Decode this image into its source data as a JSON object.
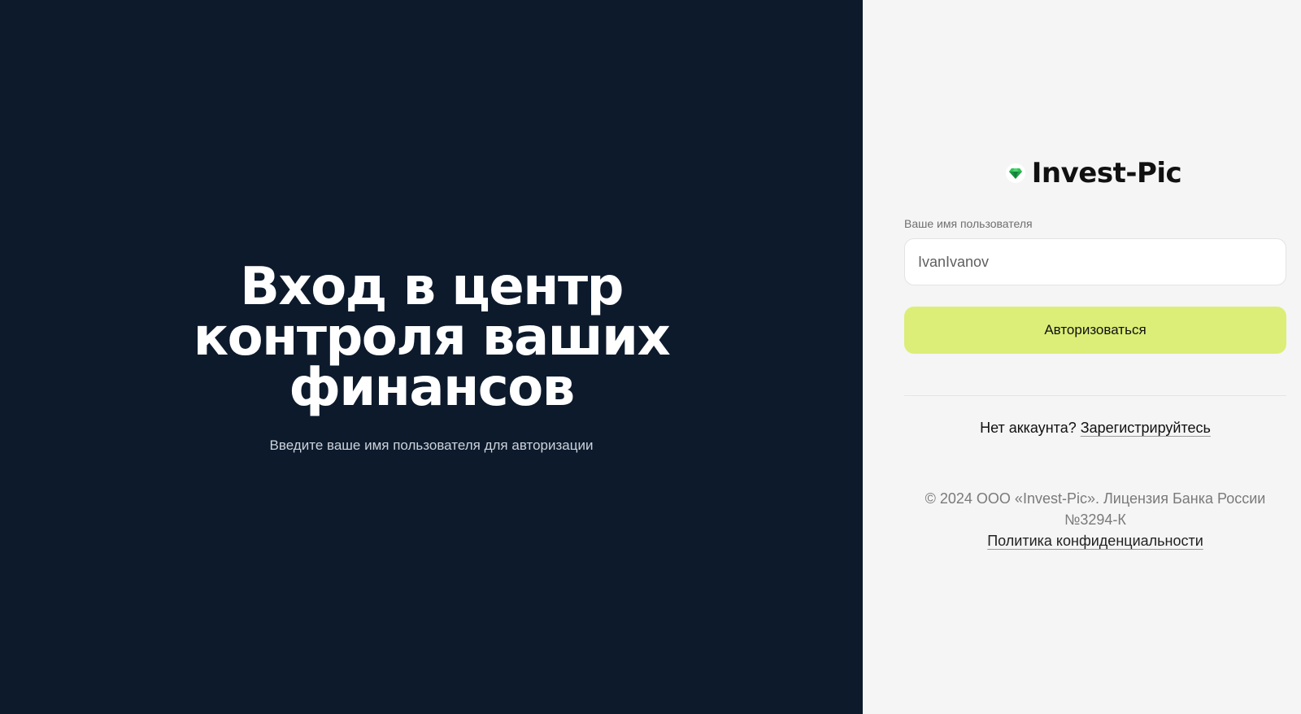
{
  "colors": {
    "left_background": "#0c1a2c",
    "right_background": "#f5f5f5",
    "accent_button": "#dcee77",
    "logo_green": "#22a447"
  },
  "hero": {
    "title_lines": [
      "Вход в центр",
      "контроля ваших",
      "финансов"
    ],
    "subtitle": "Введите ваше имя пользователя для авторизации"
  },
  "brand": {
    "name": "Invest-Pic",
    "icon": "gem-icon"
  },
  "login_form": {
    "username_label": "Ваше имя пользователя",
    "username_value": "IvanIvanov",
    "submit_label": "Авторизоваться"
  },
  "register": {
    "prompt": "Нет аккаунта?",
    "link_label": "Зарегистрируйтесь"
  },
  "footer": {
    "copyright": "© 2024 ООО «Invest-Pic». Лицензия Банка России №3294-К",
    "privacy_label": "Политика конфиденциальности"
  }
}
